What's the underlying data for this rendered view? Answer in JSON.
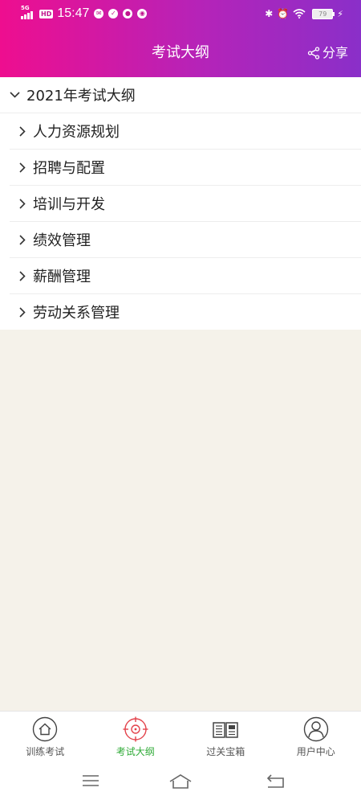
{
  "status_bar": {
    "network": "5G",
    "hd": "HD",
    "time": "15:47",
    "battery": "79"
  },
  "header": {
    "title": "考试大纲",
    "share_label": "分享"
  },
  "outline": {
    "root_label": "2021年考试大纲",
    "items": [
      {
        "label": "人力资源规划"
      },
      {
        "label": "招聘与配置"
      },
      {
        "label": "培训与开发"
      },
      {
        "label": "绩效管理"
      },
      {
        "label": "薪酬管理"
      },
      {
        "label": "劳动关系管理"
      }
    ]
  },
  "tabbar": {
    "tabs": [
      {
        "label": "训练考试",
        "icon": "home-icon"
      },
      {
        "label": "考试大纲",
        "icon": "target-icon",
        "active": true
      },
      {
        "label": "过关宝箱",
        "icon": "book-icon"
      },
      {
        "label": "用户中心",
        "icon": "user-icon"
      }
    ]
  },
  "colors": {
    "header_start": "#ee0e8f",
    "header_end": "#8a2fc9",
    "active_tab": "#2eaa36",
    "background": "#f5f2ea"
  }
}
